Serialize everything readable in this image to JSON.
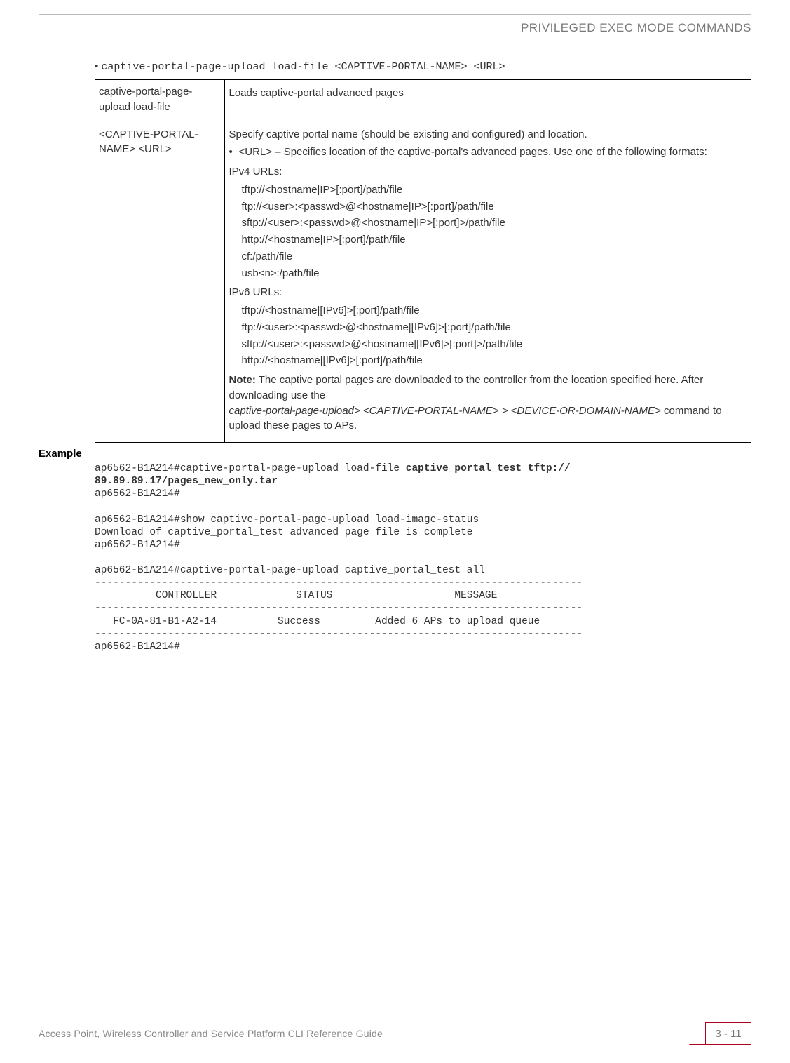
{
  "header": {
    "section_title": "PRIVILEGED EXEC MODE COMMANDS"
  },
  "syntax_line": "captive-portal-page-upload load-file <CAPTIVE-PORTAL-NAME> <URL>",
  "table": {
    "row1": {
      "c1": "captive-portal-page-upload load-file",
      "c2": "Loads captive-portal advanced pages"
    },
    "row2": {
      "c1": "<CAPTIVE-PORTAL-NAME> <URL>",
      "line1": "Specify captive portal name (should be existing and configured) and location.",
      "bullet": "<URL> – Specifies location of the captive-portal's advanced pages. Use one of the following formats:",
      "ipv4_label": "IPv4 URLs:",
      "ipv4": {
        "u1": "tftp://<hostname|IP>[:port]/path/file",
        "u2": "ftp://<user>:<passwd>@<hostname|IP>[:port]/path/file",
        "u3": "sftp://<user>:<passwd>@<hostname|IP>[:port]>/path/file",
        "u4": "http://<hostname|IP>[:port]/path/file",
        "u5": "cf:/path/file",
        "u6": "usb<n>:/path/file"
      },
      "ipv6_label": "IPv6 URLs:",
      "ipv6": {
        "u1": "tftp://<hostname|[IPv6]>[:port]/path/file",
        "u2": "ftp://<user>:<passwd>@<hostname|[IPv6]>[:port]/path/file",
        "u3": "sftp://<user>:<passwd>@<hostname|[IPv6]>[:port]>/path/file",
        "u4": "http://<hostname|[IPv6]>[:port]/path/file"
      },
      "note_prefix": "Note:",
      "note_body_1": " The captive portal pages are downloaded to the controller from the location specified here. After downloading use the ",
      "note_italic": "captive-portal-page-upload> <CAPTIVE-PORTAL-NAME> > <DEVICE-OR-DOMAIN-NAME>",
      "note_body_2": " command to upload these pages to APs."
    }
  },
  "example": {
    "label": "Example",
    "line1a": "ap6562-B1A214#captive-portal-page-upload load-file ",
    "line1b": "captive_portal_test tftp://",
    "line2b": "89.89.89.17/pages_new_only.tar",
    "line3": "ap6562-B1A214#",
    "block2_l1": "ap6562-B1A214#show captive-portal-page-upload load-image-status",
    "block2_l2": "Download of captive_portal_test advanced page file is complete",
    "block2_l3": "ap6562-B1A214#",
    "block3_l1": "ap6562-B1A214#captive-portal-page-upload captive_portal_test all",
    "dash": "--------------------------------------------------------------------------------",
    "hdr": "          CONTROLLER             STATUS                    MESSAGE",
    "row": "   FC-0A-81-B1-A2-14          Success         Added 6 APs to upload queue",
    "block3_end": "ap6562-B1A214#"
  },
  "footer": {
    "text": "Access Point, Wireless Controller and Service Platform CLI Reference Guide",
    "page": "3 - 11"
  }
}
